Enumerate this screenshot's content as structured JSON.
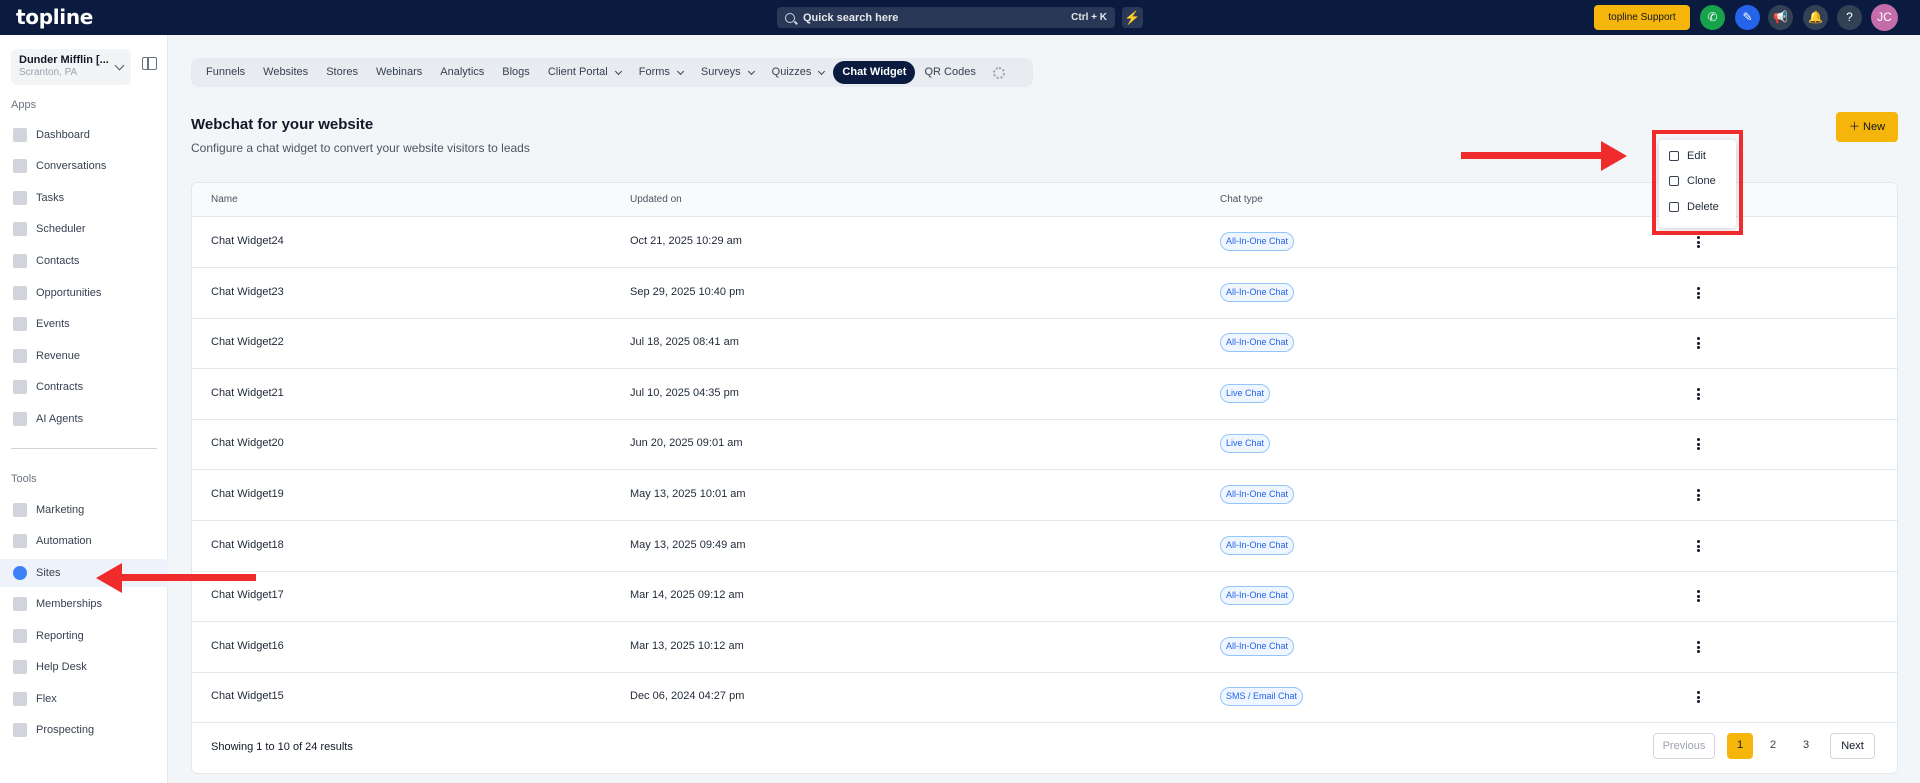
{
  "app": {
    "logo": "topline",
    "search_label": "Quick search here",
    "search_shortcut": "Ctrl + K",
    "support_label": "topline Support",
    "avatar_initials": "JC",
    "accent_color": "#f5b50a",
    "nav_bg_color": "#0b1b3f"
  },
  "account": {
    "name": "Dunder Mifflin [...",
    "location": "Scranton, PA"
  },
  "sidebar": {
    "apps_label": "Apps",
    "apps": [
      {
        "label": "Dashboard",
        "icon": "dashboard-icon"
      },
      {
        "label": "Conversations",
        "icon": "conversations-icon"
      },
      {
        "label": "Tasks",
        "icon": "tasks-icon"
      },
      {
        "label": "Scheduler",
        "icon": "calendar-icon"
      },
      {
        "label": "Contacts",
        "icon": "contacts-icon"
      },
      {
        "label": "Opportunities",
        "icon": "opportunities-icon"
      },
      {
        "label": "Events",
        "icon": "events-icon"
      },
      {
        "label": "Revenue",
        "icon": "revenue-icon"
      },
      {
        "label": "Contracts",
        "icon": "contracts-icon"
      },
      {
        "label": "AI Agents",
        "icon": "sparkle-icon"
      }
    ],
    "tools_label": "Tools",
    "tools": [
      {
        "label": "Marketing",
        "icon": "megaphone-icon"
      },
      {
        "label": "Automation",
        "icon": "automation-icon"
      },
      {
        "label": "Sites",
        "icon": "sites-icon",
        "active": true
      },
      {
        "label": "Memberships",
        "icon": "memberships-icon"
      },
      {
        "label": "Reporting",
        "icon": "reporting-icon"
      },
      {
        "label": "Help Desk",
        "icon": "help-desk-icon"
      },
      {
        "label": "Flex",
        "icon": "flex-icon"
      },
      {
        "label": "Prospecting",
        "icon": "prospecting-icon"
      }
    ]
  },
  "tabs": [
    "Funnels",
    "Websites",
    "Stores",
    "Webinars",
    "Analytics",
    "Blogs",
    "Client Portal",
    "Forms",
    "Surveys",
    "Quizzes",
    "Chat Widget",
    "QR Codes"
  ],
  "active_tab": "Chat Widget",
  "page": {
    "title": "Webchat for your website",
    "subtitle": "Configure a chat widget to convert your website visitors to leads",
    "new_button": "New"
  },
  "table": {
    "headers": [
      "Name",
      "Updated on",
      "Chat type"
    ],
    "rows": [
      {
        "name": "Chat Widget24",
        "updated": "Oct 21, 2025 10:29 am",
        "type": "All-In-One Chat"
      },
      {
        "name": "Chat Widget23",
        "updated": "Sep 29, 2025 10:40 pm",
        "type": "All-In-One Chat"
      },
      {
        "name": "Chat Widget22",
        "updated": "Jul 18, 2025 08:41 am",
        "type": "All-In-One Chat"
      },
      {
        "name": "Chat Widget21",
        "updated": "Jul 10, 2025 04:35 pm",
        "type": "Live Chat"
      },
      {
        "name": "Chat Widget20",
        "updated": "Jun 20, 2025 09:01 am",
        "type": "Live Chat"
      },
      {
        "name": "Chat Widget19",
        "updated": "May 13, 2025 10:01 am",
        "type": "All-In-One Chat"
      },
      {
        "name": "Chat Widget18",
        "updated": "May 13, 2025 09:49 am",
        "type": "All-In-One Chat"
      },
      {
        "name": "Chat Widget17",
        "updated": "Mar 14, 2025 09:12 am",
        "type": "All-In-One Chat"
      },
      {
        "name": "Chat Widget16",
        "updated": "Mar 13, 2025 10:12 am",
        "type": "All-In-One Chat"
      },
      {
        "name": "Chat Widget15",
        "updated": "Dec 06, 2024 04:27 pm",
        "type": "SMS / Email Chat"
      }
    ],
    "summary": "Showing 1 to 10 of 24 results",
    "pagination": {
      "previous": "Previous",
      "pages": [
        "1",
        "2",
        "3"
      ],
      "current": "1",
      "next": "Next"
    }
  },
  "context_menu": {
    "items": [
      {
        "label": "Edit",
        "icon": "pencil-icon"
      },
      {
        "label": "Clone",
        "icon": "copy-icon"
      },
      {
        "label": "Delete",
        "icon": "trash-icon"
      }
    ]
  },
  "annotation_color": "#ef2b2b"
}
